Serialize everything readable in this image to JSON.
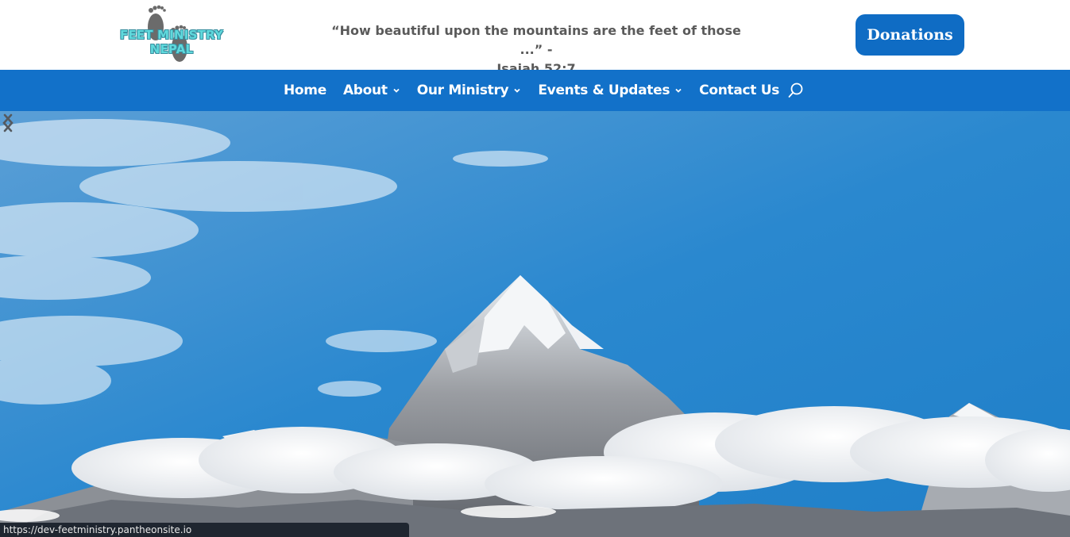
{
  "header": {
    "logo": {
      "line1": "FEET MINISTRY",
      "line2": "NEPAL",
      "icon": "footprints-icon",
      "text_color": "#5fd9dc"
    },
    "quote": {
      "line1": "“How beautiful upon the mountains are the feet of those ...” -",
      "line2": "Isaiah 52:7"
    },
    "donate_label": "Donations"
  },
  "nav": {
    "items": [
      {
        "label": "Home",
        "has_dropdown": false
      },
      {
        "label": "About",
        "has_dropdown": true
      },
      {
        "label": "Our Ministry",
        "has_dropdown": true
      },
      {
        "label": "Events & Updates",
        "has_dropdown": true
      },
      {
        "label": "Contact Us",
        "has_dropdown": false
      }
    ],
    "search_icon": "search-icon"
  },
  "hero": {
    "image": "mountain-peak-above-clouds",
    "prev_icon": "chevron-left-icon",
    "next_icon": "chevron-right-icon"
  },
  "status": {
    "url": "https://dev-feetministry.pantheonsite.io"
  },
  "colors": {
    "brand_blue": "#1271c9",
    "button_blue": "#0f6cc4",
    "quote_gray": "#5a5a5a"
  }
}
